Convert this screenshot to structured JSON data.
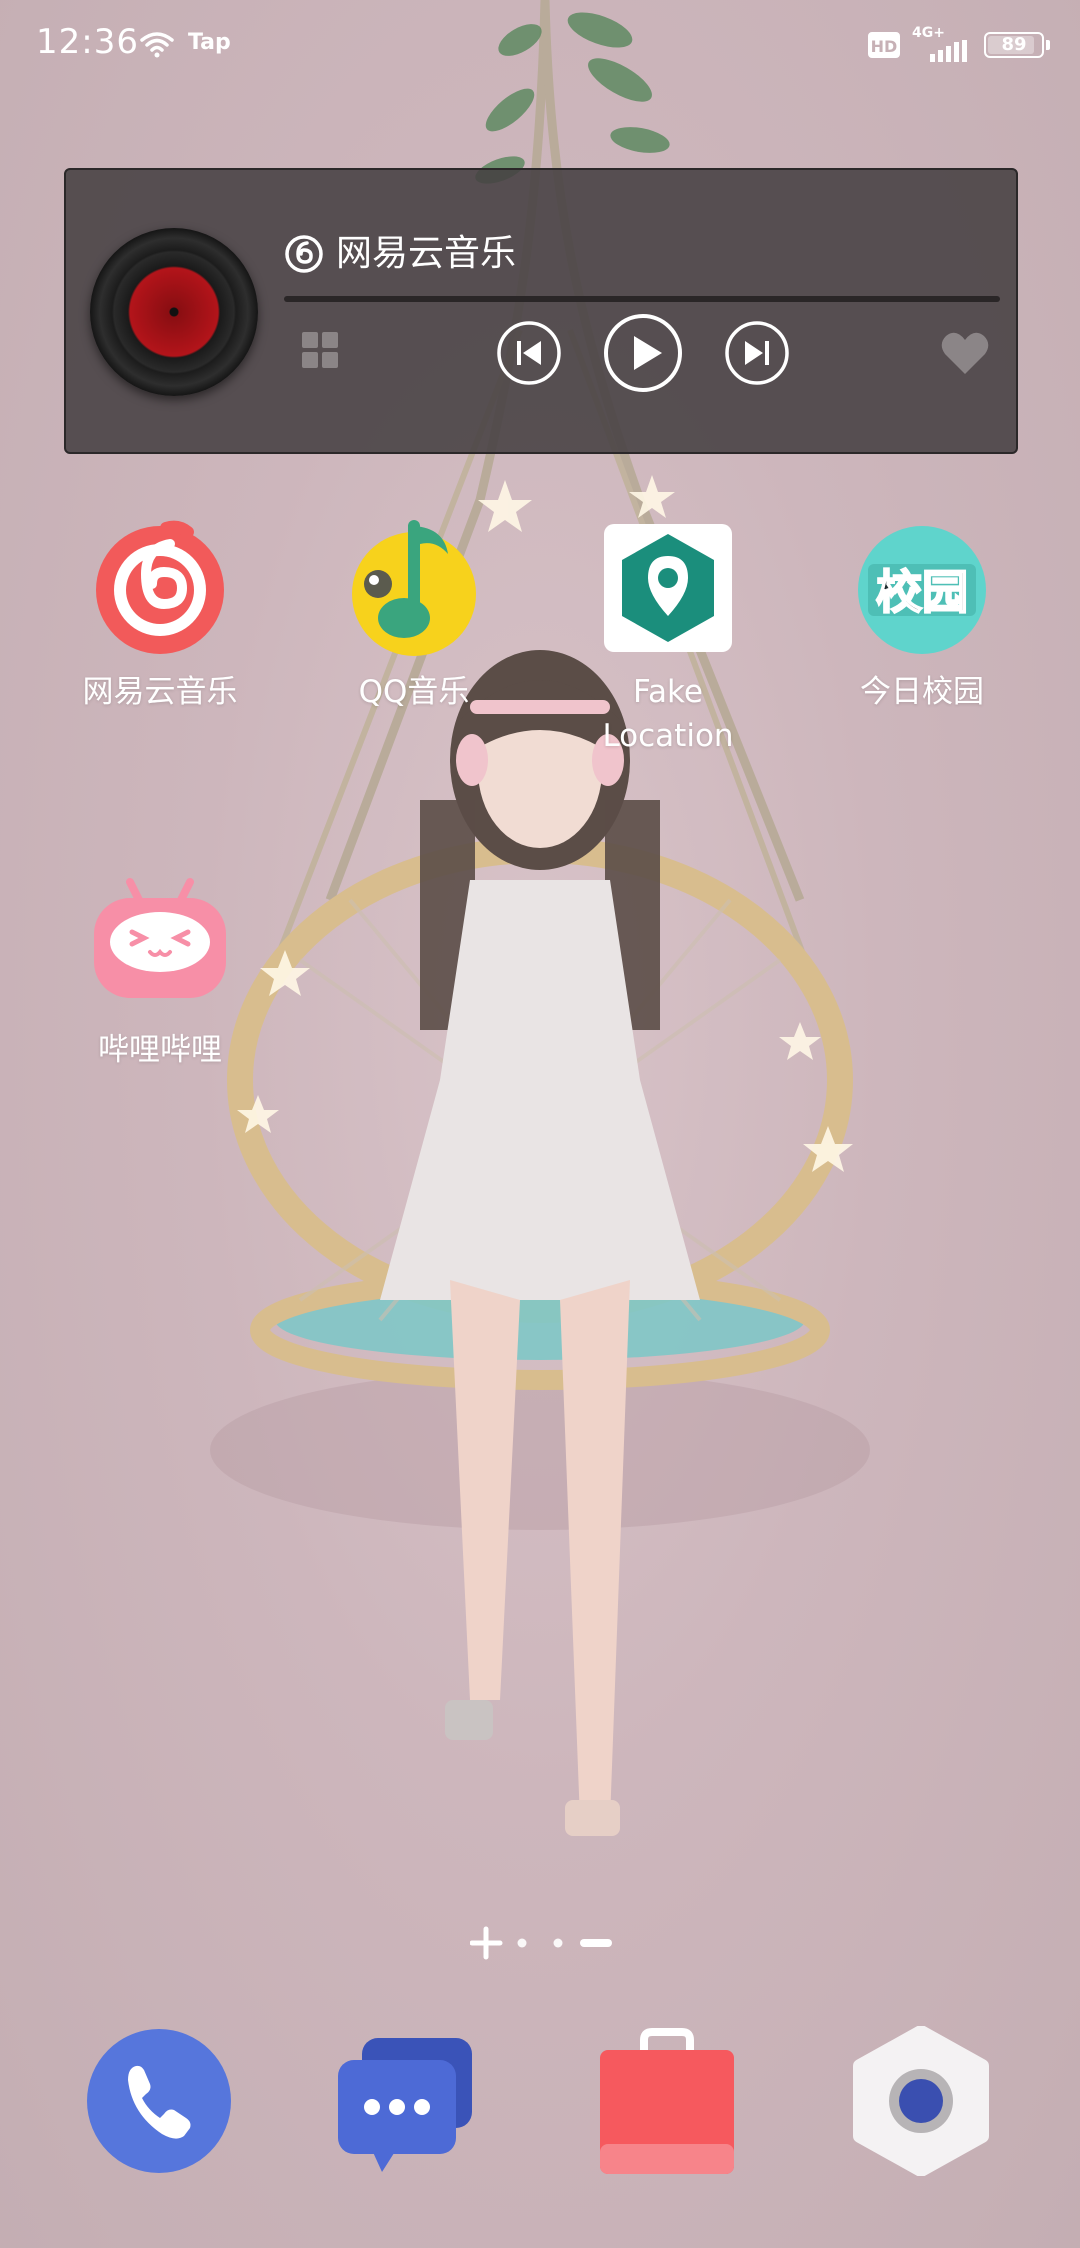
{
  "status_bar": {
    "time": "12:36",
    "tap_label": "Tap",
    "hd_label": "HD",
    "network_label": "4G+",
    "battery_level": "89",
    "battery_fraction": 0.89
  },
  "music_widget": {
    "app_name": "网易云音乐",
    "progress": 0.0,
    "icons": [
      "vinyl-record",
      "netease-logo",
      "grid-icon",
      "previous-icon",
      "play-icon",
      "next-icon",
      "heart-icon"
    ]
  },
  "apps": [
    {
      "label": "网易云音乐",
      "icon": "netease-music-icon",
      "color": "#f25a5a"
    },
    {
      "label": "QQ音乐",
      "icon": "qq-music-icon",
      "color": "#f7d21c"
    },
    {
      "label": "Fake\nLocation",
      "icon": "fake-location-icon",
      "color": "#1b8e7c"
    },
    {
      "label": "今日校园",
      "icon": "today-campus-icon",
      "color": "#5fd4cc"
    },
    {
      "label": "哔哩哔哩",
      "icon": "bilibili-icon",
      "color": "#f78fa7"
    }
  ],
  "page_indicator": {
    "pages": 4,
    "current": 3
  },
  "dock": [
    {
      "icon": "phone-icon",
      "color": "#5676dc"
    },
    {
      "icon": "messages-icon",
      "color": "#4d6ad6"
    },
    {
      "icon": "app-store-bag-icon",
      "color": "#f6595e"
    },
    {
      "icon": "camera-icon",
      "color": "#3a4fb0"
    }
  ]
}
